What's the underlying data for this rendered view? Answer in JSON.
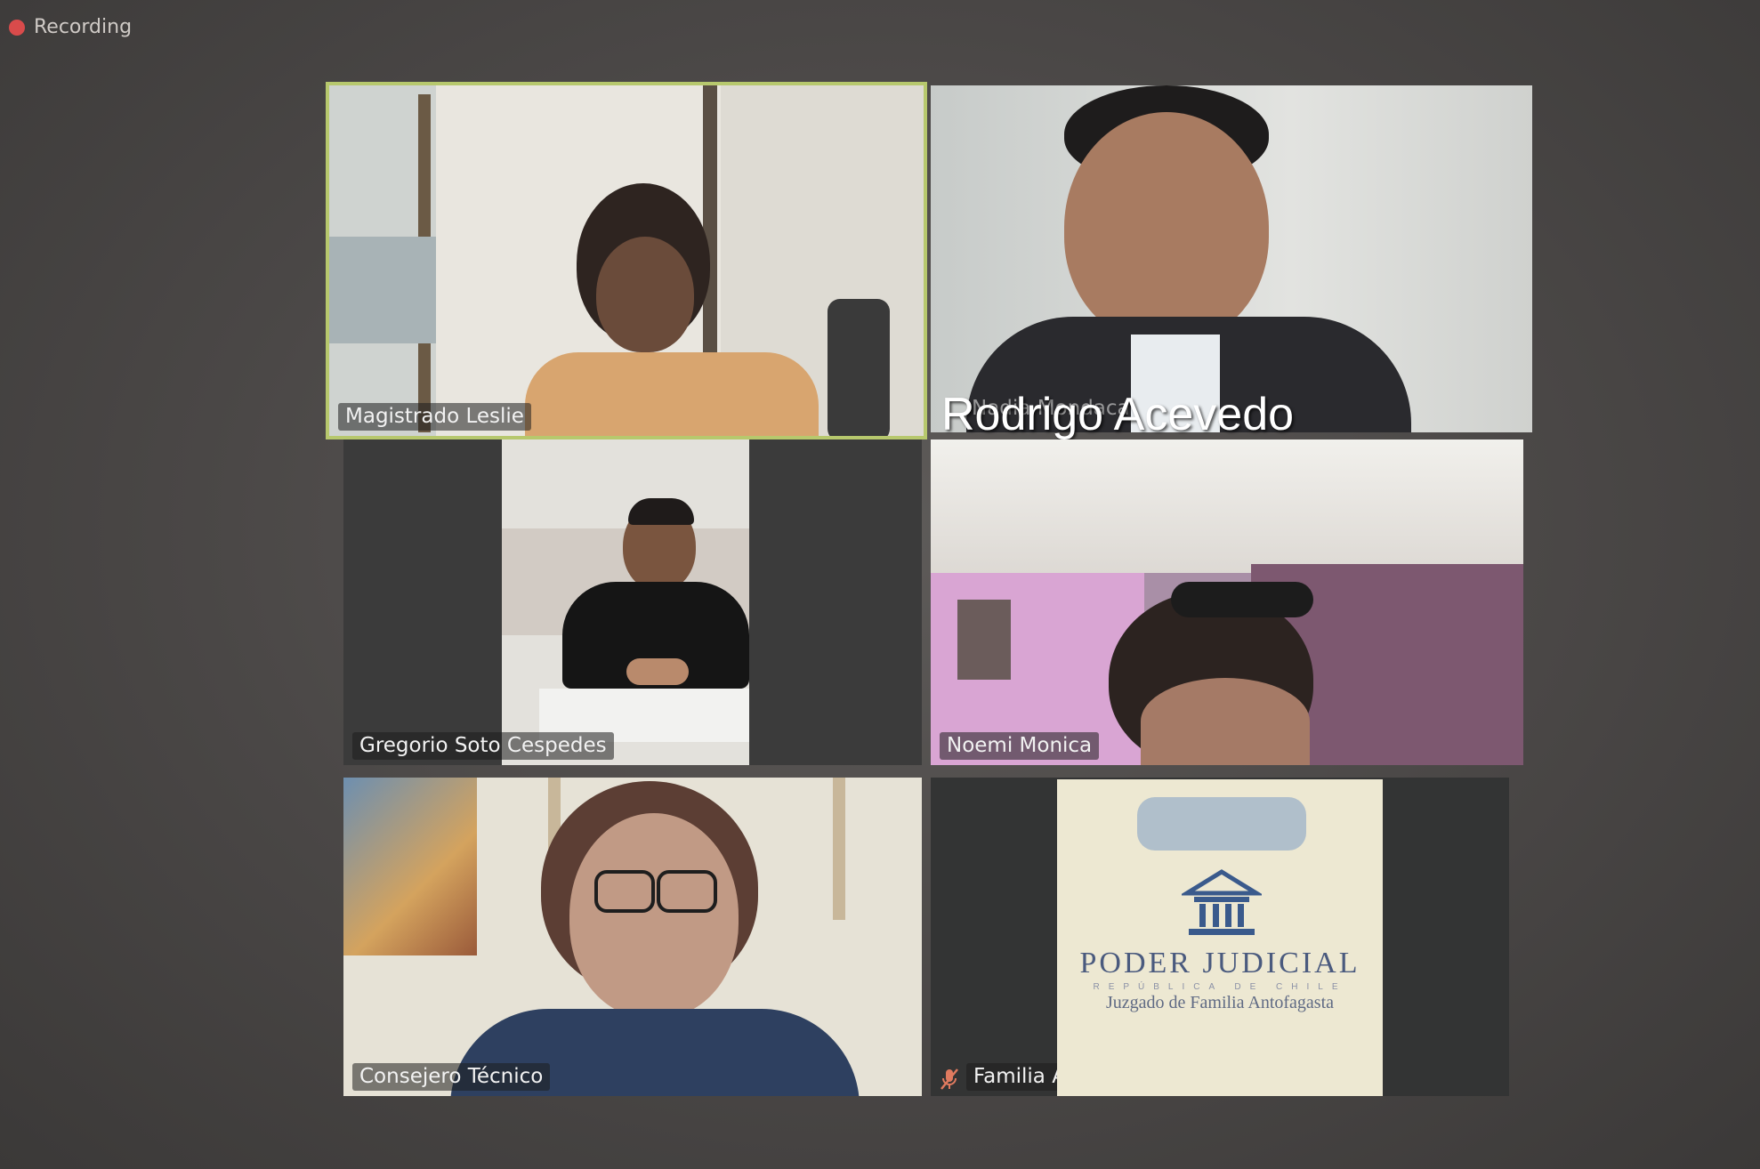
{
  "recording": {
    "label": "Recording",
    "color": "#d94b4b"
  },
  "participants": [
    {
      "name": "Magistrado Leslie",
      "active_speaker": true
    },
    {
      "name": "Rodrigo Acevedo",
      "overlay_name": "Nadia Mondaca"
    },
    {
      "name": "Gregorio Soto Cespedes"
    },
    {
      "name": "Noemi Monica"
    },
    {
      "name": "Consejero Técnico"
    },
    {
      "name": "Familia Antofagasta",
      "muted": true,
      "icon": "muted-mic-icon"
    }
  ],
  "caption": {
    "text": "Rodrigo Acevedo"
  },
  "logo": {
    "title": "PODER JUDICIAL",
    "subtitle": "REPÚBLICA DE CHILE",
    "court": "Juzgado de Familia Antofagasta"
  },
  "colors": {
    "active_speaker_border": "#b7c86d",
    "logo_text": "#4a5a7e"
  }
}
